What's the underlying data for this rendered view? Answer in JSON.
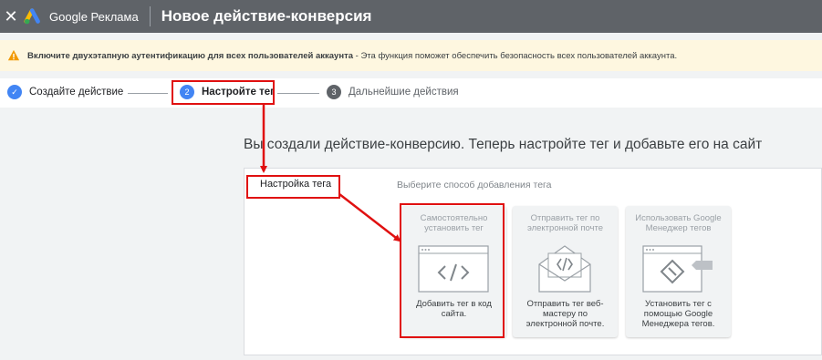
{
  "header": {
    "close_icon": "close-icon",
    "brand": "Google Реклама",
    "title": "Новое действие-конверсия",
    "bg_color": "#5f6368"
  },
  "banner": {
    "text_bold": "Включите двухэтапную аутентификацию для всех пользователей аккаунта",
    "text_rest": " - Эта функция поможет обеспечить безопасность всех пользователей аккаунта.",
    "icon": "warning-icon",
    "bg_color": "#fef7e0"
  },
  "stepper": {
    "steps": [
      {
        "label": "Создайте действие",
        "state": "done"
      },
      {
        "number": "2",
        "label": "Настройте тег",
        "state": "current"
      },
      {
        "number": "3",
        "label": "Дальнейшие действия",
        "state": "upcoming"
      }
    ]
  },
  "main": {
    "headline": "Вы создали действие-конверсию. Теперь настройте тег и добавьте его на сайт",
    "panel_label": "Настройка тега",
    "panel_hint": "Выберите способ добавления тега",
    "cards": [
      {
        "title": "Самостоятельно установить тег",
        "desc": "Добавить тег в код сайта.",
        "icon": "code-window-icon"
      },
      {
        "title": "Отправить тег по электронной почте",
        "desc": "Отправить тег веб-мастеру по электронной почте.",
        "icon": "email-code-icon"
      },
      {
        "title": "Использовать Google Менеджер тегов",
        "desc": "Установить тег с помощью Google Менеджера тегов.",
        "icon": "tag-manager-icon"
      }
    ]
  },
  "annotation_color": "#e01010"
}
